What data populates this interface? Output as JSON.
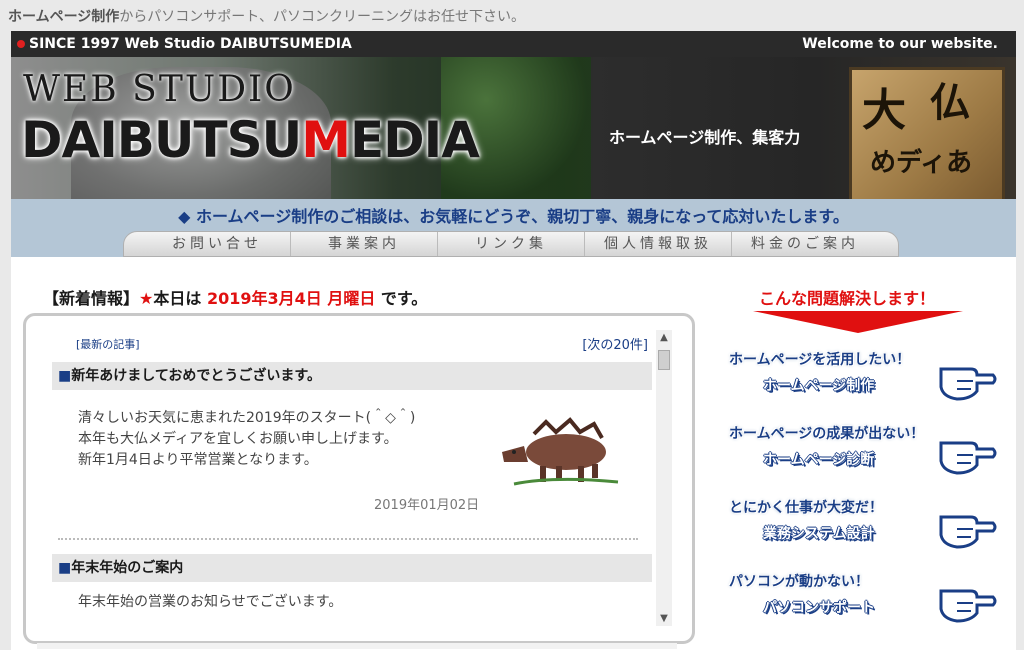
{
  "tagline": {
    "bold": "ホームページ制作",
    "rest": "からパソコンサポート、パソコンクリーニングはお任せ下さい。"
  },
  "topbar": {
    "left": "SINCE 1997 Web Studio DAIBUTSUMEDIA",
    "right": "Welcome to our website."
  },
  "banner": {
    "ws": "WEB STUDIO",
    "dm_pre": "DAIBUTSU",
    "dm_m": "M",
    "dm_post": "EDIA",
    "slogan": "ホームページ制作、集客力",
    "sign1": "大",
    "sign2": "仏",
    "sign3": "めディあ"
  },
  "notice": "◆ ホームページ制作のご相談は、お気軽にどうぞ、親切丁寧、親身になって応対いたします。",
  "nav": [
    "お問い合せ",
    "事業案内",
    "リンク集",
    "個人情報取扱",
    "料金のご案内"
  ],
  "news": {
    "heading_pre": "【新着情報】",
    "star": "★",
    "heading_mid": "本日は",
    "date": "2019年3月4日 月曜日",
    "heading_post": "です。",
    "latest_label": "[最新の記事]",
    "next_label": "[次の20件]",
    "articles": [
      {
        "title": "新年あけましておめでとうございます。",
        "lines": [
          "清々しいお天気に恵まれた2019年のスタート(＾◇＾)",
          "本年も大仏メディアを宜しくお願い申し上げます。",
          "新年1月4日より平常営業となります。"
        ],
        "date": "2019年01月02日"
      },
      {
        "title": "年末年始のご案内",
        "lines": [
          "年末年始の営業のお知らせでございます。"
        ]
      }
    ],
    "square": "■"
  },
  "side": {
    "heading": "こんな問題解決します！",
    "items": [
      {
        "q": "ホームページを活用したい！",
        "a": "ホームページ制作"
      },
      {
        "q": "ホームページの成果が出ない！",
        "a": "ホームページ診断"
      },
      {
        "q": "とにかく仕事が大変だ！",
        "a": "業務システム設計"
      },
      {
        "q": "パソコンが動かない！",
        "a": "パソコンサポート"
      }
    ]
  },
  "colors": {
    "accent_red": "#e01010",
    "link_blue": "#1a3e86",
    "notice_bg": "#b4c6d6"
  }
}
